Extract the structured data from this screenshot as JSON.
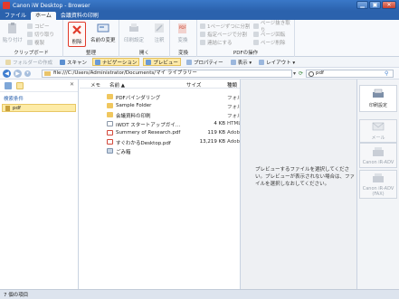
{
  "window": {
    "title": "Canon iW Desktop - Browser",
    "buttons": [
      "▁",
      "▣",
      "✕"
    ]
  },
  "menu_tabs": [
    "ファイル",
    "ホーム",
    "会議資料の印刷"
  ],
  "ribbon": {
    "clipboard": {
      "label": "クリップボード",
      "paste": "貼り付け",
      "copy": "コピー",
      "cut": "切り取り",
      "duplicate": "複製"
    },
    "edit": {
      "label": "整理",
      "delete": "削除",
      "rename": "名前の変更"
    },
    "open": {
      "label": "開く",
      "print_settings": "印刷設定",
      "annotation": "注釈"
    },
    "convert": {
      "label": "変換",
      "convert_btn": "変換"
    },
    "pdf": {
      "label": "PDFの操作",
      "split_each": "1ページずつに分割",
      "split_range": "指定ページで分割",
      "merge": "連結にする",
      "extract": "ページ抜き取り",
      "rotate": "ページ回転",
      "delete": "ページ削除"
    }
  },
  "navbar": {
    "folder_op": "フォルダーの作成",
    "scan": "スキャン",
    "navigation": "ナビゲーション",
    "preview": "プレビュー",
    "property": "プロパティー",
    "view": "表示 ▾",
    "layout": "レイアウト ▾"
  },
  "address": {
    "path": "file:///C:/Users/Administrator/Documents/マイ ライブラリー",
    "search": "pdf"
  },
  "left_pane": {
    "header": "検索条件",
    "item": "pdf"
  },
  "file_list": {
    "columns": {
      "memo": "メモ",
      "name": "名前 ▲",
      "size": "サイズ",
      "type": "種類"
    },
    "rows": [
      {
        "name": "PDFバインダリング",
        "size": "",
        "type": "フォルダー",
        "icon": "folder-icon"
      },
      {
        "name": "Sample Folder",
        "size": "",
        "type": "フォルダー",
        "icon": "folder-icon"
      },
      {
        "name": "会議資料の印刷",
        "size": "",
        "type": "フォルダー",
        "icon": "folder-icon"
      },
      {
        "name": "iWDT スタートアップガイ…",
        "size": "4 KB",
        "type": "HTML",
        "icon": "html-icon"
      },
      {
        "name": "Summery of Research.pdf",
        "size": "119 KB",
        "type": "Adobe",
        "icon": "pdf-icon"
      },
      {
        "name": "すぐわかるDesktop.pdf",
        "size": "13,219 KB",
        "type": "Adobe",
        "icon": "pdf-icon"
      },
      {
        "name": "ごみ箱",
        "size": "",
        "type": "",
        "icon": "trash-icon"
      }
    ]
  },
  "preview": {
    "message": "プレビューするファイルを選択してください。プレビューが表示されない場合は、ファイルを選択しなおしてください。"
  },
  "right_pane": {
    "buttons": [
      {
        "label": "印刷設定",
        "enabled": true
      },
      {
        "label": "メール",
        "enabled": false
      },
      {
        "label": "Canon iR-ADV",
        "enabled": false
      },
      {
        "label": "Canon iR-ADV (FAX)",
        "enabled": false
      }
    ]
  },
  "status": {
    "text": "7 個の項目"
  },
  "colors": {
    "accent": "#2b62ad",
    "delete_highlight": "#e03a2a",
    "selection": "#fdeba6"
  }
}
